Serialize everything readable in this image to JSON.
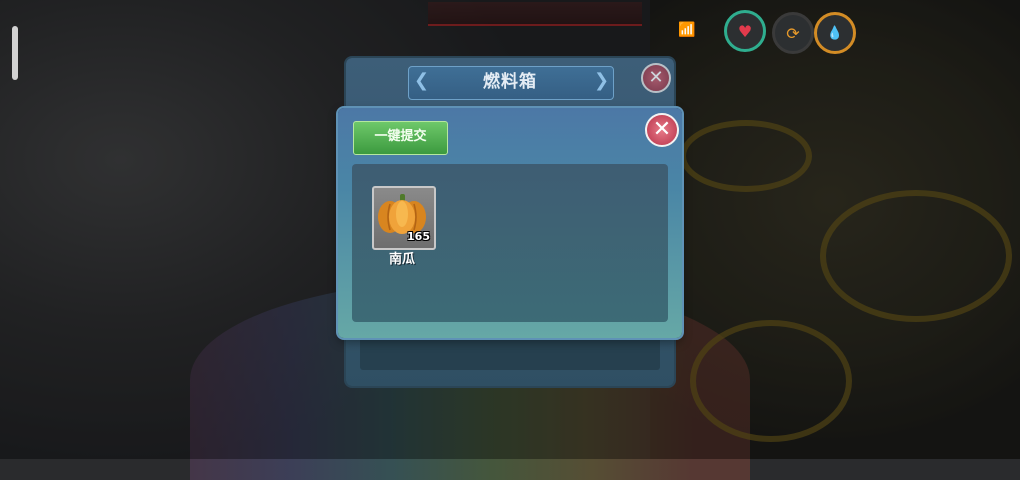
{
  "back_dialog": {
    "title": "燃料箱",
    "close_symbol": "✕",
    "title_deco_left": "❮",
    "title_deco_right": "❯"
  },
  "dialog": {
    "submit_all_label": "一键提交",
    "close_symbol": "✕"
  },
  "items": [
    {
      "name": "南瓜",
      "count": "165",
      "icon": "pumpkin-icon"
    }
  ],
  "hud": {
    "icons": [
      "signal-icon",
      "heart-icon",
      "refresh-icon",
      "water-drop-icon"
    ],
    "heart_symbol": "♥",
    "refresh_symbol": "⟳",
    "drop_symbol": "💧",
    "wifi_symbol": "📶"
  },
  "colors": {
    "accent_green": "#3c9a3f",
    "close_red": "#b8324a",
    "panel_blue": "#4c78a6"
  }
}
